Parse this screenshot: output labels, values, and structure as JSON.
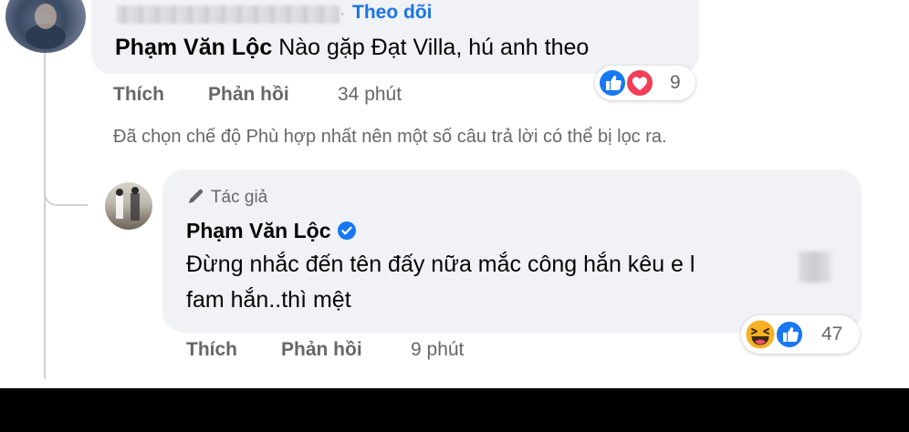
{
  "first_comment": {
    "follow_separator": "·",
    "follow_label": "Theo dõi",
    "author": "Phạm Văn Lộc",
    "text": "Nào gặp Đạt Villa, hú anh theo",
    "reaction_count": "9",
    "actions": {
      "like": "Thích",
      "reply": "Phản hồi",
      "time": "34 phút"
    }
  },
  "filter_note": "Đã chọn chế độ Phù hợp nhất nên một số câu trả lời có thể bị lọc ra.",
  "reply": {
    "badge": "Tác giả",
    "author": "Phạm Văn Lộc",
    "line1": "Đừng nhắc đến tên đấy nữa mắc công hắn kêu e l",
    "line2": "fam hắn..thì mệt",
    "reaction_count": "47",
    "actions": {
      "like": "Thích",
      "reply": "Phản hồi",
      "time": "9 phút"
    }
  },
  "colors": {
    "link_blue": "#1b74e4",
    "like_blue": "#1877f2",
    "love_red": "#f33e58",
    "haha_yellow": "#f7b125",
    "secondary_text": "#65676b",
    "bubble": "#f0f2f5"
  },
  "icons": [
    "like-reaction-icon",
    "love-reaction-icon",
    "haha-reaction-icon",
    "pen-icon",
    "verified-badge-icon"
  ]
}
